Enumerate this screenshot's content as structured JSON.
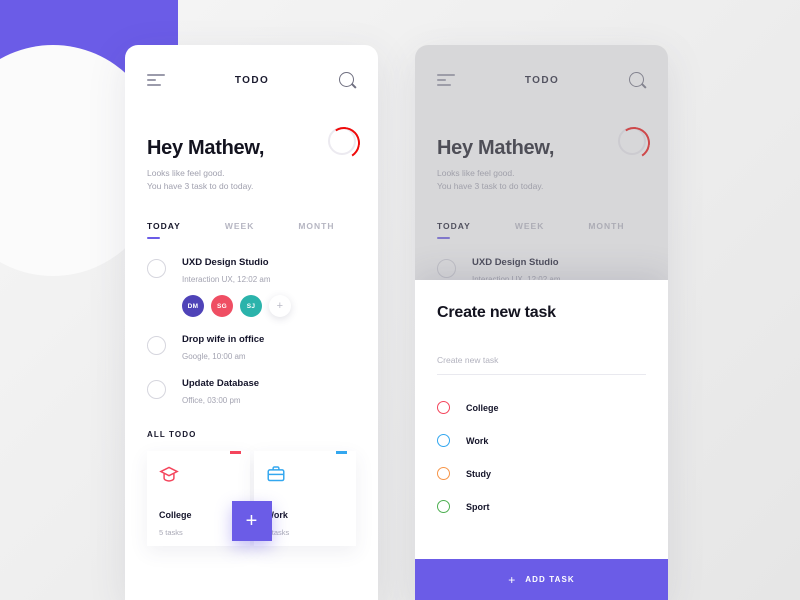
{
  "app": {
    "brand": "TODO",
    "menu_icon": "hamburger-icon",
    "search_icon": "search-icon"
  },
  "greeting": {
    "title": "Hey Mathew,",
    "line1": "Looks like feel good.",
    "line2": "You have 3 task to do today.",
    "progress_color": "#ef0a0a",
    "progress_percent": 32
  },
  "tabs": [
    {
      "label": "TODAY",
      "active": true
    },
    {
      "label": "WEEK",
      "active": false
    },
    {
      "label": "MONTH",
      "active": false
    }
  ],
  "tasks": [
    {
      "title": "UXD Design Studio",
      "subtitle": "Interaction UX, 12:02 am",
      "avatars": [
        {
          "initials": "DM",
          "color": "#4f43b8"
        },
        {
          "initials": "SG",
          "color": "#ef4e63"
        },
        {
          "initials": "SJ",
          "color": "#2bb3ab"
        }
      ],
      "add_label": "+"
    },
    {
      "title": "Drop wife in office",
      "subtitle": "Google,  10:00 am",
      "avatars": []
    },
    {
      "title": "Update Database",
      "subtitle": "Office,    03:00 pm",
      "avatars": []
    }
  ],
  "all_todo": {
    "heading": "ALL TODO",
    "cards": [
      {
        "title": "College",
        "count": "5 tasks",
        "color": "#f4455c",
        "icon": "graduation-cap-icon"
      },
      {
        "title": "Work",
        "count": "7 tasks",
        "color": "#33a7ef",
        "icon": "briefcase-icon"
      }
    ],
    "fab_label": "+"
  },
  "modal": {
    "title": "Create new task",
    "input_placeholder": "Create new task",
    "input_value": "",
    "options": [
      {
        "label": "College",
        "color": "#f4455c"
      },
      {
        "label": "Work",
        "color": "#33a7ef"
      },
      {
        "label": "Study",
        "color": "#f79548"
      },
      {
        "label": "Sport",
        "color": "#4caf50"
      }
    ],
    "submit_plus": "+",
    "submit_label": "ADD TASK",
    "accent_color": "#6b5ce7"
  }
}
